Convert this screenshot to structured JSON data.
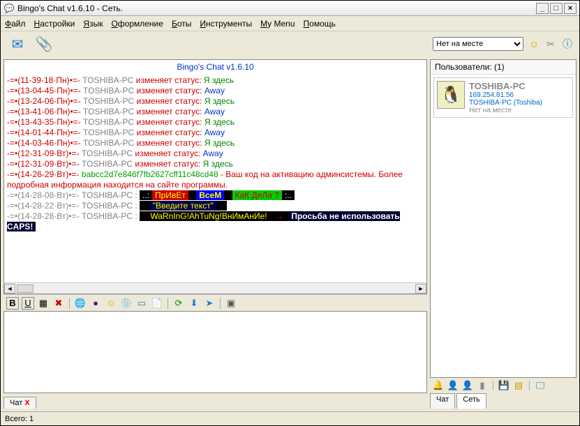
{
  "title": "Bingo's Chat v1.6.10 - Сеть.",
  "menu": [
    "Файл",
    "Настройки",
    "Язык",
    "Оформление",
    "Боты",
    "Инструменты",
    "My Menu",
    "Помощь"
  ],
  "status_dropdown": "Нет на месте",
  "chat_header": "Bingo's Chat v1.6.10",
  "log": [
    {
      "ts": "-=•(11-39-18·Пн)•=-",
      "tsc": "red",
      "pc": "TOSHIBA-PC",
      "act": "изменяет статус:",
      "st": "Я здесь",
      "stc": "green"
    },
    {
      "ts": "-=•(13-04-45·Пн)•=-",
      "tsc": "red",
      "pc": "TOSHIBA-PC",
      "act": "изменяет статус:",
      "st": "Away",
      "stc": "blue"
    },
    {
      "ts": "-=•(13-24-06·Пн)•=-",
      "tsc": "red",
      "pc": "TOSHIBA-PC",
      "act": "изменяет статус:",
      "st": "Я здесь",
      "stc": "green"
    },
    {
      "ts": "-=•(13-41-06·Пн)•=-",
      "tsc": "red",
      "pc": "TOSHIBA-PC",
      "act": "изменяет статус:",
      "st": "Away",
      "stc": "blue"
    },
    {
      "ts": "-=•(13-43-35·Пн)•=-",
      "tsc": "red",
      "pc": "TOSHIBA-PC",
      "act": "изменяет статус:",
      "st": "Я здесь",
      "stc": "green"
    },
    {
      "ts": "-=•(14-01-44·Пн)•=-",
      "tsc": "red",
      "pc": "TOSHIBA-PC",
      "act": "изменяет статус:",
      "st": "Away",
      "stc": "blue"
    },
    {
      "ts": "-=•(14-03-46·Пн)•=-",
      "tsc": "red",
      "pc": "TOSHIBA-PC",
      "act": "изменяет статус:",
      "st": "Я здесь",
      "stc": "green"
    },
    {
      "ts": "-=•(12-31-09·Вт)•=-",
      "tsc": "red",
      "pc": "TOSHIBA-PC",
      "act": "изменяет статус:",
      "st": "Away",
      "stc": "blue"
    },
    {
      "ts": "-=•(12-31-09·Вт)•=-",
      "tsc": "red",
      "pc": "TOSHIBA-PC",
      "act": "изменяет статус:",
      "st": "Я здесь",
      "stc": "green"
    }
  ],
  "code_line": {
    "ts": "-=•(14-26-29·Вт)•=-",
    "code": "babcc2d7e846f7fb2627cff11c48cd48",
    "tail": " - Ваш код на активацию админсистемы. Более подробная информация находится на сайте программы."
  },
  "msg1": {
    "ts": "-=•(14-28-08·Вт)•=-",
    "pc": "TOSHIBA-PC : ",
    "p1": "ПрИвЕт",
    "p2": "ВсеМ",
    "p3": "КаК ДеЛа ?"
  },
  "msg2": {
    "ts": "-=•(14-28-22·Вт)•=-",
    "pc": "TOSHIBA-PC : ",
    "txt": "\"Введите текст\""
  },
  "msg3": {
    "ts": "-=•(14-28-28·Вт)•=-",
    "pc": "TOSHIBA-PC : ",
    "warn": "WaRnInG!AhTuNg!ВнИмАнИе!",
    "tail": "Просьба не использовать CAPS!"
  },
  "users_header": "Пользователи: (1)",
  "user": {
    "name": "TOSHIBA-PC",
    "ip": "169.254.81.56",
    "full": "TOSHIBA-PC (Toshiba)",
    "status": "Нет на месте"
  },
  "tab_chat": "Чат",
  "tab_net": "Сеть",
  "statusbar": "Всего: 1"
}
